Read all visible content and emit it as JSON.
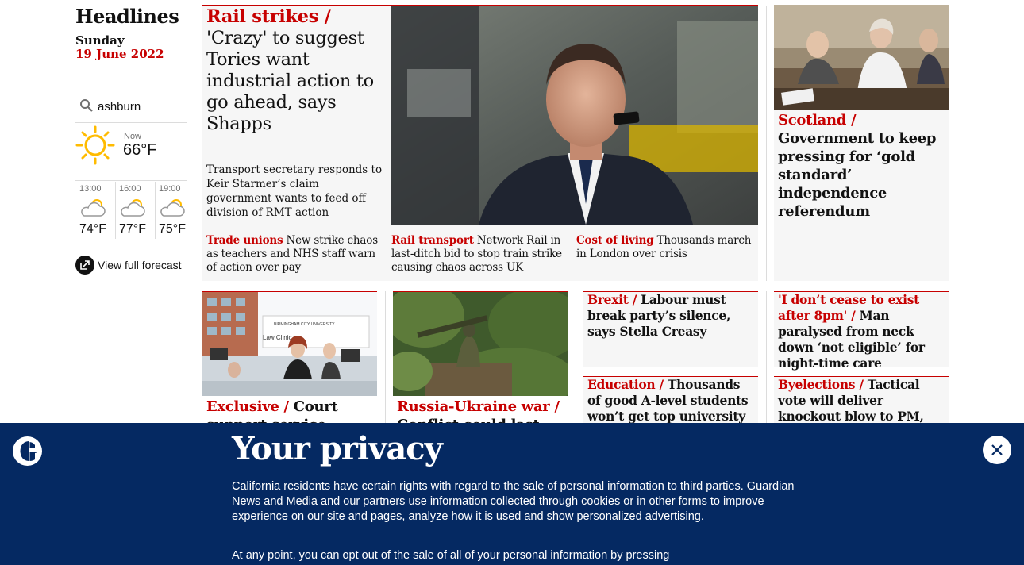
{
  "sidebar": {
    "title": "Headlines",
    "day": "Sunday",
    "date": "19 June 2022",
    "search_value": "ashburn",
    "weather_now_label": "Now",
    "weather_now_temp": "66°F",
    "forecast": [
      {
        "time": "13:00",
        "temp": "74°F"
      },
      {
        "time": "16:00",
        "temp": "77°F"
      },
      {
        "time": "19:00",
        "temp": "75°F"
      }
    ],
    "full_forecast_label": "View full forecast"
  },
  "lead": {
    "kicker": "Rail strikes /",
    "headline": " 'Crazy' to suggest Tories want industrial action to go ahead, says Shapps",
    "standfirst": "Transport secretary responds to Keir Starmer’s claim government wants to feed off division of RMT action"
  },
  "sublinks": [
    {
      "kicker": "Trade unions",
      "text": " New strike chaos as teachers and NHS staff warn of action over pay"
    },
    {
      "kicker": "Rail transport",
      "text": " Network Rail in last-ditch bid to stop train strike causing chaos across UK"
    },
    {
      "kicker": "Cost of living",
      "text": " Thousands march in London over crisis"
    }
  ],
  "scotland": {
    "kicker": "Scotland /",
    "headline": "Government to keep pressing for ‘gold standard’ independence referendum"
  },
  "row2": [
    {
      "kicker": "Exclusive /",
      "headline": " Court support service under"
    },
    {
      "kicker": "Russia-Ukraine war /",
      "headline": " Conflict could last for"
    }
  ],
  "small_stories": [
    {
      "kicker": "Brexit /",
      "headline": " Labour must break party’s silence, says Stella Creasy"
    },
    {
      "kicker": "'I don’t cease to exist after 8pm' /",
      "headline": " Man paralysed from neck down ‘not eligible’ for night-time care"
    },
    {
      "kicker": "Education /",
      "headline": " Thousands of good A-level students won’t get top university"
    },
    {
      "kicker": "Byelections /",
      "headline": " Tactical vote will deliver knockout blow to PM, say Lib Dems as poll"
    }
  ],
  "photo_labels": {
    "clinic_sign": "Law Clinic",
    "university": "BIRMINGHAM CITY UNIVERSITY"
  },
  "privacy": {
    "title": "Your privacy",
    "para1": "California residents have certain rights with regard to the sale of personal information to third parties. Guardian News and Media and our partners use information collected through cookies or in other forms to improve experience on our site and pages, analyze how it is used and show personalized advertising.",
    "para2": "At any point, you can opt out of the sale of all of your personal information by pressing"
  },
  "colors": {
    "accent": "#c70000",
    "banner": "#052962",
    "card": "#f6f6f6"
  },
  "icons": [
    "search-icon",
    "sun-icon",
    "partly-cloudy-icon",
    "external-link-icon",
    "guardian-logo-icon",
    "close-icon"
  ]
}
